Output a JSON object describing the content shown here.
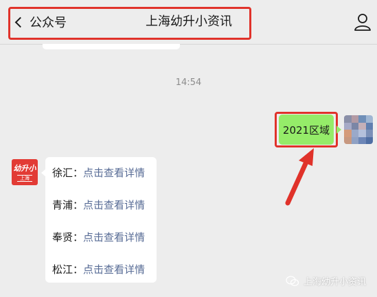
{
  "header": {
    "back_label": "公众号",
    "title": "上海幼升小资讯"
  },
  "chat": {
    "timestamp": "14:54",
    "my_message": "2021区域",
    "oa_avatar": {
      "line1": "幼升小",
      "line2": "上海"
    },
    "oa_rows": [
      {
        "district": "徐汇：",
        "link": "点击查看详情"
      },
      {
        "district": "青浦：",
        "link": "点击查看详情"
      },
      {
        "district": "奉贤：",
        "link": "点击查看详情"
      },
      {
        "district": "松江：",
        "link": "点击查看详情"
      }
    ]
  },
  "watermark": {
    "text": "上海幼升小资讯"
  },
  "colors": {
    "background": "#ededed",
    "my_bubble": "#95ec69",
    "link": "#576b95",
    "highlight": "#e0322a",
    "brand": "#e23b35"
  }
}
